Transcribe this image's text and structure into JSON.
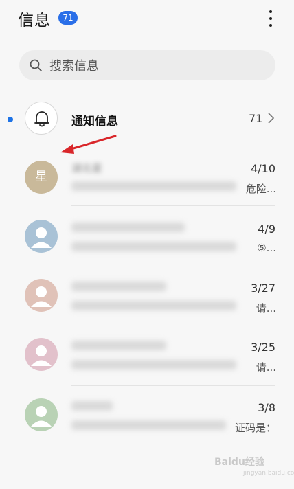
{
  "header": {
    "title": "信息",
    "unread_badge": "71"
  },
  "search": {
    "placeholder": "搜索信息"
  },
  "notifications": {
    "label": "通知信息",
    "count": "71"
  },
  "messages": [
    {
      "avatar_text": "星",
      "avatar_color": "#c9b99a",
      "sender": "湖北星",
      "date": "4/10",
      "preview_tail": "危险..."
    },
    {
      "avatar_text": "",
      "avatar_color": "#a9c2d6",
      "sender": "",
      "date": "4/9",
      "preview_tail": "⑤..."
    },
    {
      "avatar_text": "",
      "avatar_color": "#e0c2b8",
      "sender": "",
      "date": "3/27",
      "preview_tail": "请..."
    },
    {
      "avatar_text": "",
      "avatar_color": "#e2c1cb",
      "sender": "",
      "date": "3/25",
      "preview_tail": "请..."
    },
    {
      "avatar_text": "",
      "avatar_color": "#b9d2b5",
      "sender": "",
      "date": "3/8",
      "preview_tail": "证码是："
    }
  ],
  "watermark": {
    "text": "Baidu经验",
    "sub": "jingyan.baidu.com"
  },
  "colors": {
    "accent": "#2a6fe8",
    "unread_dot": "#1e73e6",
    "annotation_arrow": "#d9262a"
  }
}
